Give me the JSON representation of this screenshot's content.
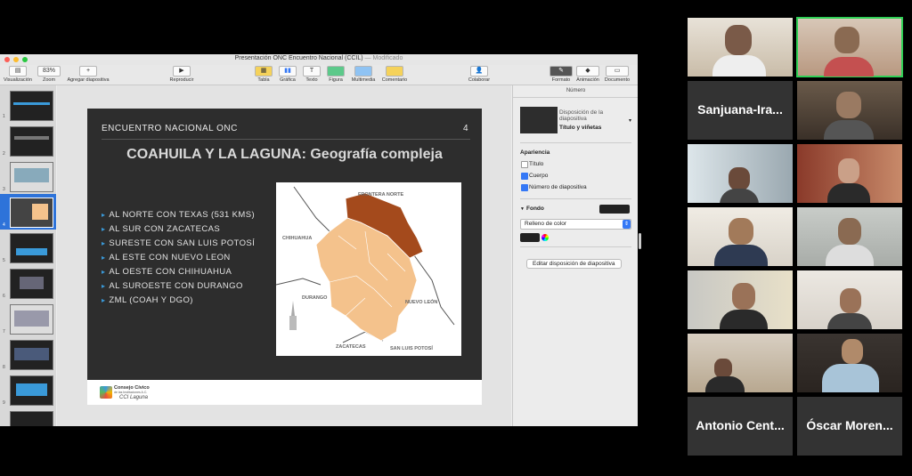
{
  "window": {
    "title": "Presentación ONC Encuentro Nacional (CCIL)",
    "modified": "— Modificado"
  },
  "toolbar": {
    "view_label": "Visualización",
    "zoom_value": "83%",
    "zoom_label": "Zoom",
    "add_slide_label": "Agregar diapositiva",
    "play_label": "Reproducir",
    "table_label": "Tabla",
    "chart_label": "Gráfica",
    "text_label": "Texto",
    "shape_label": "Figura",
    "media_label": "Multimedia",
    "comment_label": "Comentario",
    "collaborate_label": "Colaborar",
    "format_label": "Formato",
    "animate_label": "Animación",
    "document_label": "Documento"
  },
  "navigator": {
    "slides": [
      "1",
      "2",
      "3",
      "4",
      "5",
      "6",
      "7",
      "8",
      "9"
    ],
    "selected_index": 4
  },
  "slide": {
    "header": "ENCUENTRO NACIONAL ONC",
    "number": "4",
    "title": "COAHUILA Y LA LAGUNA: Geografía compleja",
    "bullets": [
      "AL NORTE CON TEXAS (531 KMS)",
      "AL SUR CON ZACATECAS",
      "SURESTE CON SAN LUIS POTOSÍ",
      "AL ESTE CON NUEVO LEON",
      "AL OESTE CON CHIHUAHUA",
      "AL SUROESTE CON DURANGO",
      "ZML (COAH Y DGO)"
    ],
    "map_labels": {
      "north": "FRONTERA NORTE",
      "west": "CHIHUAHUA",
      "southwest": "DURANGO",
      "east": "NUEVO LEÓN",
      "south": "ZACATECAS",
      "southeast": "SAN LUIS POTOSÍ"
    },
    "footer_logo_line1": "Consejo Cívico",
    "footer_logo_line2": "de las Instituciones A.C.",
    "footer_logo_line3": "CCI Laguna"
  },
  "inspector": {
    "header": "Número",
    "layout_label": "Disposición de la diapositiva",
    "layout_value": "Título y viñetas",
    "appearance_label": "Apariencia",
    "options": [
      {
        "label": "Título",
        "checked": false
      },
      {
        "label": "Cuerpo",
        "checked": true
      },
      {
        "label": "Número de diapositiva",
        "checked": true
      }
    ],
    "background_label": "Fondo",
    "fill_value": "Relleno de color",
    "edit_layout_button": "Editar disposición de diapositiva"
  },
  "participants": [
    {
      "name": "",
      "type": "video",
      "selected": false
    },
    {
      "name": "",
      "type": "video",
      "selected": true
    },
    {
      "name": "Sanjuana-Ira...",
      "type": "name"
    },
    {
      "name": "",
      "type": "video"
    },
    {
      "name": "",
      "type": "video"
    },
    {
      "name": "",
      "type": "video"
    },
    {
      "name": "",
      "type": "video"
    },
    {
      "name": "",
      "type": "video"
    },
    {
      "name": "",
      "type": "video"
    },
    {
      "name": "",
      "type": "video"
    },
    {
      "name": "",
      "type": "video"
    },
    {
      "name": "",
      "type": "video"
    },
    {
      "name": "Antonio Cent...",
      "type": "name"
    },
    {
      "name": "Óscar Moren...",
      "type": "name"
    }
  ],
  "colors": {
    "accent_green": "#2fd056",
    "bullet_blue": "#3a9ad9",
    "map_light": "#f4c28c",
    "map_dark": "#a44a1c",
    "slide_bg": "#2d2d2d"
  }
}
